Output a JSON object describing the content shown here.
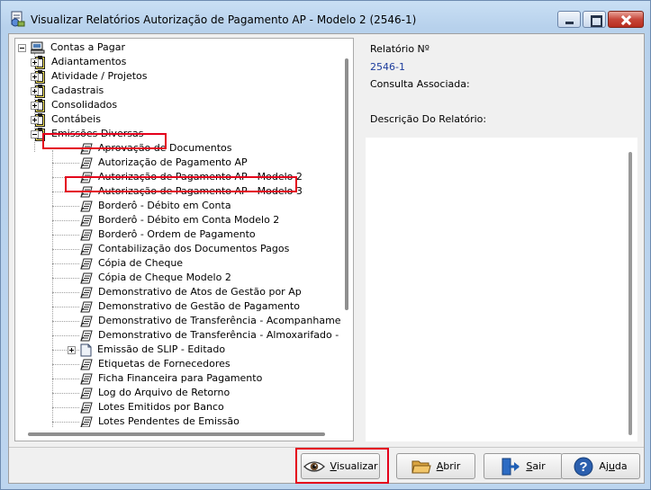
{
  "window": {
    "title": "Visualizar Relatórios Autorização de Pagamento AP - Modelo 2 (2546-1)"
  },
  "tree": {
    "root": {
      "label": "Contas a Pagar",
      "icon": "computer-icon"
    },
    "folders": [
      {
        "label": "Adiantamentos",
        "state": "collapsed"
      },
      {
        "label": "Atividade / Projetos",
        "state": "collapsed"
      },
      {
        "label": "Cadastrais",
        "state": "collapsed"
      },
      {
        "label": "Consolidados",
        "state": "collapsed"
      },
      {
        "label": "Contábeis",
        "state": "collapsed"
      },
      {
        "label": "Emissões Diversas",
        "state": "expanded"
      }
    ],
    "reports": [
      {
        "label": "Aprovação de Documentos"
      },
      {
        "label": "Autorização de Pagamento AP"
      },
      {
        "label": "Autorização de Pagamento AP - Modelo 2"
      },
      {
        "label": "Autorização de Pagamento AP - Modelo 3"
      },
      {
        "label": "Borderô - Débito em Conta"
      },
      {
        "label": "Borderô - Débito em Conta Modelo 2"
      },
      {
        "label": "Borderô - Ordem de Pagamento"
      },
      {
        "label": "Contabilização dos Documentos Pagos"
      },
      {
        "label": "Cópia de Cheque"
      },
      {
        "label": "Cópia de Cheque Modelo 2"
      },
      {
        "label": "Demonstrativo de Atos de Gestão por Ap"
      },
      {
        "label": "Demonstrativo de Gestão de Pagamento"
      },
      {
        "label": "Demonstrativo de Transferência - Acompanhamento"
      },
      {
        "label": "Demonstrativo de Transferência - Almoxarifado - Agru"
      },
      {
        "label": "Emissão de SLIP - Editado",
        "expandable": true
      },
      {
        "label": "Etiquetas de Fornecedores"
      },
      {
        "label": "Ficha Financeira para Pagamento"
      },
      {
        "label": "Log do Arquivo de Retorno"
      },
      {
        "label": "Lotes Emitidos por Banco"
      },
      {
        "label": "Lotes Pendentes de Emissão"
      }
    ]
  },
  "info": {
    "report_number_label": "Relatório Nº",
    "report_number_value": "2546-1",
    "associated_query_label": "Consulta Associada:",
    "associated_query_value": "",
    "description_label": "Descrição Do Relatório:",
    "description_value": ""
  },
  "buttons": {
    "visualizar": {
      "first": "V",
      "rest": "isualizar"
    },
    "abrir": {
      "first": "A",
      "rest": "brir"
    },
    "sair": {
      "first": "S",
      "rest": "air"
    },
    "ajuda": {
      "pre": "Aj",
      "ul": "u",
      "post": "da"
    }
  },
  "colors": {
    "highlight": "#e4001b",
    "info_value": "#1c3c9c",
    "folder": "#f5e35a"
  }
}
